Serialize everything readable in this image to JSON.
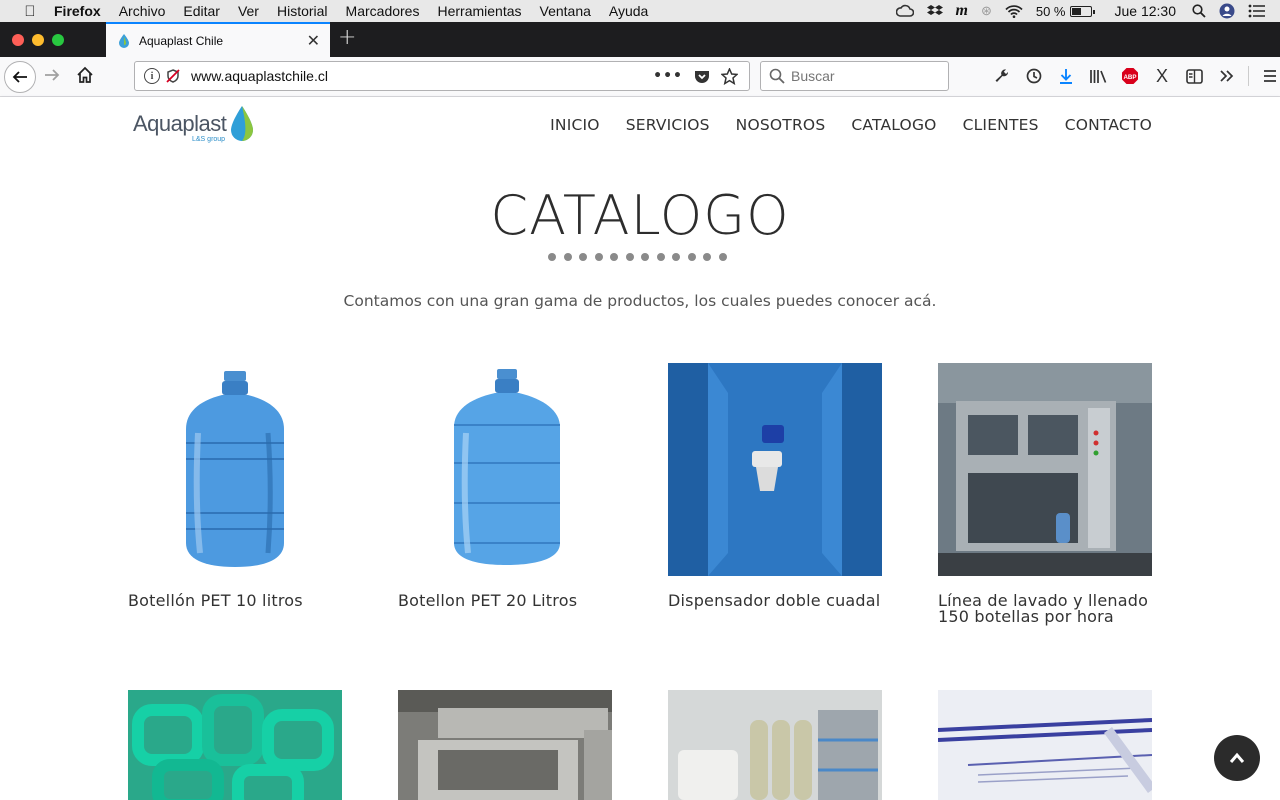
{
  "os_menubar": {
    "app_name": "Firefox",
    "menus": [
      "Archivo",
      "Editar",
      "Ver",
      "Historial",
      "Marcadores",
      "Herramientas",
      "Ventana",
      "Ayuda"
    ],
    "battery": "50 %",
    "clock": "Jue 12:30"
  },
  "browser": {
    "tab_title": "Aquaplast Chile",
    "url": "www.aquaplastchile.cl",
    "search_placeholder": "Buscar"
  },
  "site": {
    "logo_text": "Aquaplast",
    "logo_subtext": "L&S group",
    "nav": [
      "INICIO",
      "SERVICIOS",
      "NOSOTROS",
      "CATALOGO",
      "CLIENTES",
      "CONTACTO"
    ],
    "title": "CATALOGO",
    "intro": "Contamos con una gran gama de productos, los cuales puedes conocer acá.",
    "products": [
      {
        "name": "Botellón PET 10 litros",
        "icon": "water-bottle-10l-image"
      },
      {
        "name": "Botellon PET 20 Litros",
        "icon": "water-bottle-20l-image"
      },
      {
        "name": "Dispensador doble cuadal",
        "icon": "water-dispenser-image"
      },
      {
        "name": "Línea de lavado y llenado 150 botellas por hora",
        "icon": "washing-filling-line-image"
      },
      {
        "name": "",
        "icon": "green-bottle-handles-image"
      },
      {
        "name": "",
        "icon": "sealing-machine-image"
      },
      {
        "name": "",
        "icon": "water-treatment-plant-image"
      },
      {
        "name": "",
        "icon": "security-seals-image"
      }
    ]
  },
  "colors": {
    "accent_blue": "#0a84ff",
    "bottle_blue": "#3d8fd6",
    "dispenser_blue": "#2f78c4",
    "title_text": "#2d2d2d"
  }
}
